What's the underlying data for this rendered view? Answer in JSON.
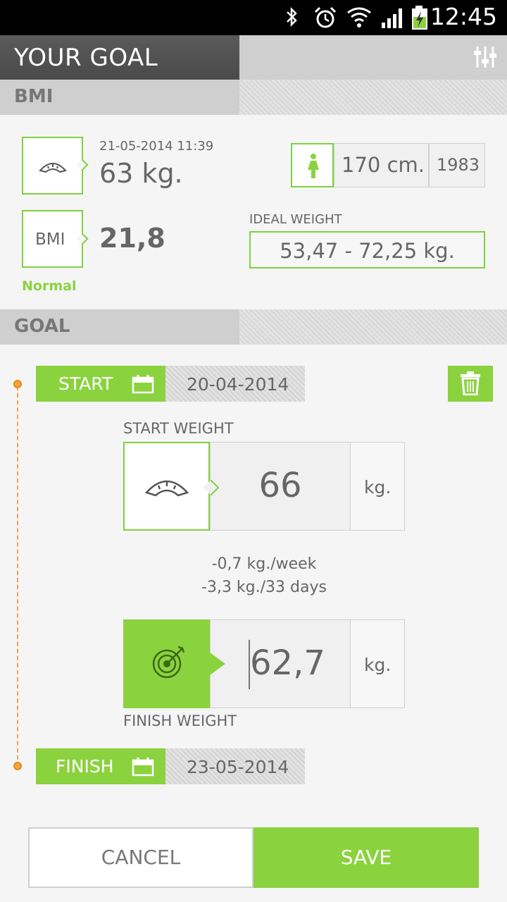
{
  "status_bar": {
    "time": "12:45",
    "icons": [
      "bluetooth-icon",
      "alarm-icon",
      "wifi-icon",
      "signal-icon",
      "battery-charging-icon"
    ]
  },
  "app_bar": {
    "title": "YOUR GOAL",
    "settings_icon": "sliders-icon"
  },
  "bmi_section": {
    "header": "BMI",
    "weight_date": "21-05-2014 11:39",
    "weight_value": "63 kg.",
    "scale_icon": "scale-icon",
    "gender_icon": "female-icon",
    "height": "170 cm.",
    "birth_year": "1983",
    "bmi_label": "BMI",
    "bmi_value": "21,8",
    "bmi_status": "Normal",
    "ideal_weight_label": "IDEAL WEIGHT",
    "ideal_weight_value": "53,47 - 72,25 kg."
  },
  "goal_section": {
    "header": "GOAL",
    "start_label": "START",
    "start_date": "20-04-2014",
    "calendar_icon": "calendar-icon",
    "trash_icon": "trash-icon",
    "start_weight_label": "START WEIGHT",
    "start_weight_value": "66",
    "start_weight_unit": "kg.",
    "rate_per_week": "-0,7 kg./week",
    "rate_total": "-3,3 kg./33 days",
    "target_icon": "target-icon",
    "finish_weight_value": "62,7",
    "finish_weight_unit": "kg.",
    "finish_weight_label": "FINISH WEIGHT",
    "finish_label": "FINISH",
    "finish_date": "23-05-2014"
  },
  "actions": {
    "cancel_label": "CANCEL",
    "save_label": "SAVE"
  },
  "colors": {
    "accent_green": "#8bd23f",
    "timeline_orange": "#f5a43d",
    "header_gray": "#4a4a4a"
  }
}
